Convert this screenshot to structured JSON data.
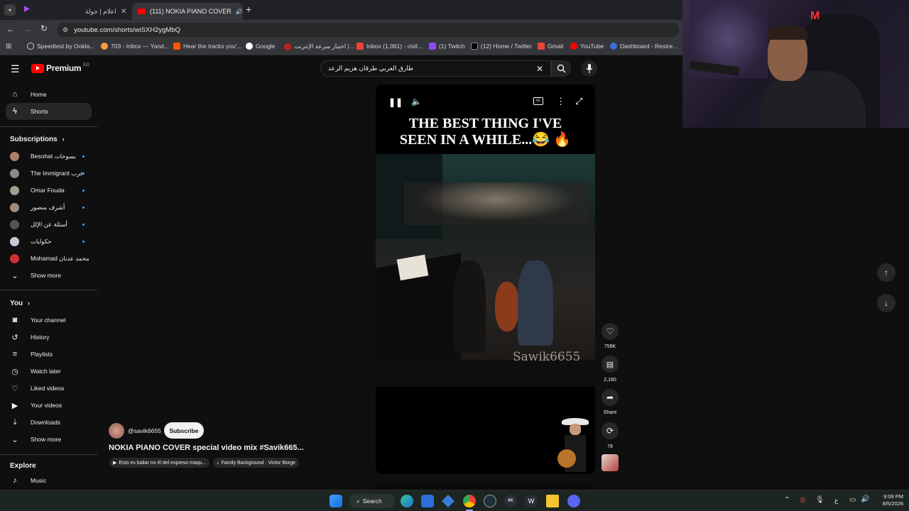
{
  "browser": {
    "tabs": [
      {
        "title": "اعلام | جولة",
        "active": false
      },
      {
        "title": "(111) NOKIA PIANO COVER",
        "active": true
      }
    ],
    "url": "youtube.com/shorts/wiSXH2ygMbQ",
    "bookmarks": [
      "Speedtest by Ookla...",
      "703 - Inbox — Yand...",
      "Hear the tracks you'...",
      "Google",
      "اختبار سرعة الإنترنت |...",
      "Inbox (1,061) - civil...",
      "(1) Twitch",
      "(12) Home / Twitter",
      "Gmail",
      "YouTube",
      "Dashboard - Restre..."
    ]
  },
  "header": {
    "logo_text": "Premium",
    "region": "EG",
    "search_value": "طارق العربي طرقان هزيم الرعد"
  },
  "sidebar": {
    "main": [
      {
        "label": "Home",
        "icon": "home-icon"
      },
      {
        "label": "Shorts",
        "icon": "shorts-icon",
        "active": true
      }
    ],
    "subscriptions_title": "Subscriptions",
    "subscriptions": [
      {
        "label": "Besohat بسوحات",
        "color": "#b0806a"
      },
      {
        "label": "The Immigrant عرب",
        "color": "#8a8a8a"
      },
      {
        "label": "Omar Fouda",
        "color": "#9aa08a"
      },
      {
        "label": "أشرف منصور",
        "color": "#a08c80"
      },
      {
        "label": "أسئلة عن الإلل",
        "color": "#555555"
      },
      {
        "label": "حكوايات",
        "color": "#c8c8d8"
      },
      {
        "label": "Mohamad محمد عدنان",
        "color": "#d03030"
      }
    ],
    "show_more": "Show more",
    "you_title": "You",
    "you_items": [
      {
        "label": "Your channel",
        "icon": "your-channel-icon"
      },
      {
        "label": "History",
        "icon": "history-icon"
      },
      {
        "label": "Playlists",
        "icon": "playlists-icon"
      },
      {
        "label": "Watch later",
        "icon": "watch-later-icon"
      },
      {
        "label": "Liked videos",
        "icon": "liked-videos-icon"
      },
      {
        "label": "Your videos",
        "icon": "your-videos-icon"
      },
      {
        "label": "Downloads",
        "icon": "downloads-icon"
      }
    ],
    "show_more_2": "Show more",
    "explore_title": "Explore",
    "explore_items": [
      {
        "label": "Music",
        "icon": "music-icon"
      }
    ]
  },
  "video": {
    "overlay_text_line1": "THE BEST THING I'VE",
    "overlay_text_line2": "SEEN IN A WHILE...😂 🔥",
    "watermark": "Sawik6655",
    "channel": "@savik6655",
    "subscribe_label": "Subscribe",
    "title": "NOKIA PIANO COVER  special video mix #Savik665...",
    "music_chips": [
      "Esto es bailar no él del expreso maqu...",
      "Family Background · Victor Borge"
    ]
  },
  "actions": {
    "likes": "759K",
    "comments": "2,160",
    "share": "Share",
    "remix": "78"
  },
  "taskbar": {
    "search_label": "Search",
    "language": "ع",
    "time": "9:09 PM",
    "date": "8/5/2026"
  },
  "colors": {
    "youtube_red": "#ff0000",
    "subscribe_bg": "#f1f1f1",
    "page_bg": "#0f0f0f",
    "shorts_active_bg": "#272727"
  }
}
